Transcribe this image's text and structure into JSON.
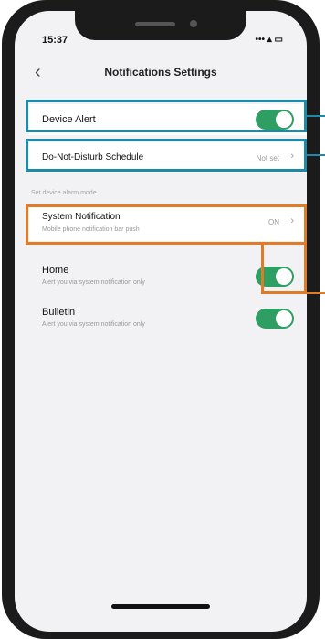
{
  "status_bar": {
    "time": "15:37",
    "icons": "••• ▴ ▭"
  },
  "header": {
    "back_icon": "‹",
    "title": "Notifications Settings"
  },
  "device_alert": {
    "label": "Device Alert",
    "enabled": true
  },
  "dnd": {
    "label": "Do-Not-Disturb Schedule",
    "value": "Not set",
    "chevron": "›"
  },
  "section": {
    "label": "Set device alarm mode"
  },
  "system_notification": {
    "label": "System Notification",
    "sub": "Mobile phone notification bar push",
    "value": "ON",
    "chevron": "›"
  },
  "home": {
    "label": "Home",
    "sub": "Alert you via system notification only",
    "enabled": true
  },
  "bulletin": {
    "label": "Bulletin",
    "sub": "Alert you via system notification only",
    "enabled": true
  },
  "colors": {
    "toggle_on": "#2f9e63",
    "highlight_blue": "#1e8aa7",
    "highlight_orange": "#e07b27"
  }
}
